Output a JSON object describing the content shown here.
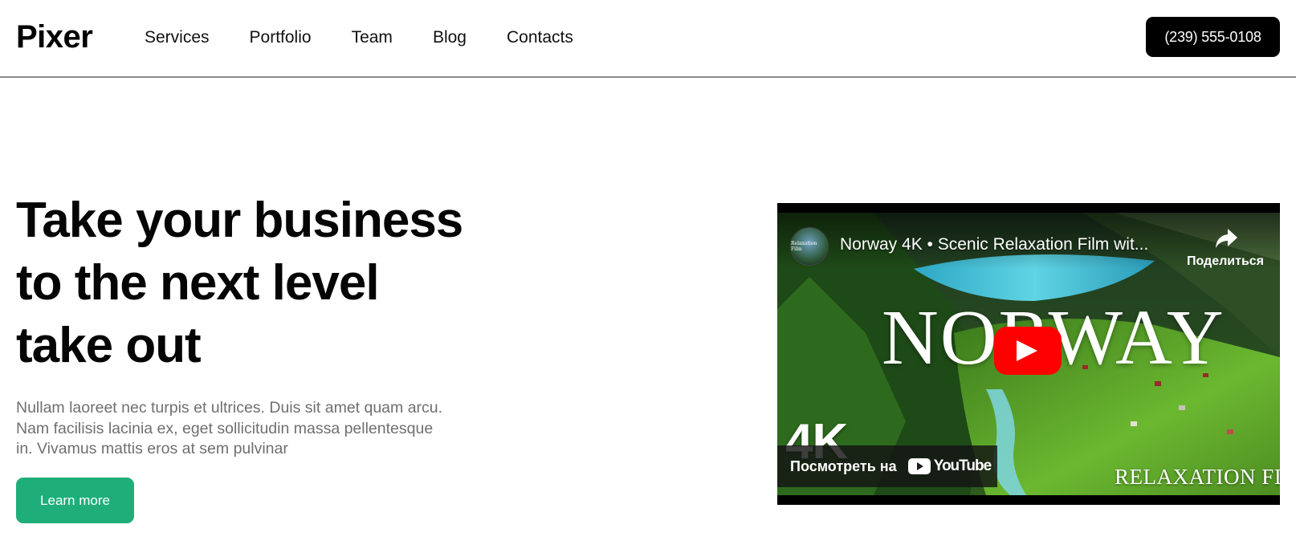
{
  "header": {
    "logo": "Pixer",
    "nav": [
      "Services",
      "Portfolio",
      "Team",
      "Blog",
      "Contacts"
    ],
    "phone": "(239) 555-0108"
  },
  "hero": {
    "title_lines": [
      "Take your business",
      "to the next level",
      "take out"
    ],
    "text_lines": [
      "Nullam laoreet nec turpis et ultrices. Duis sit amet quam arcu.",
      "Nam facilisis lacinia ex, eget sollicitudin massa pellentesque",
      "in. Vivamus mattis eros at sem pulvinar"
    ],
    "button": "Learn more"
  },
  "video": {
    "title": "Norway 4K • Scenic Relaxation Film wit...",
    "share_label": "Поделиться",
    "overlay_word": "Norway",
    "badge": "4K",
    "watch_label": "Посмотреть на",
    "youtube_word": "YouTube",
    "watermark": "Relaxation Film",
    "channel_avatar_text": "Relaxation Film",
    "colors": {
      "play": "#ff0000",
      "button": "#1fae7a"
    }
  }
}
